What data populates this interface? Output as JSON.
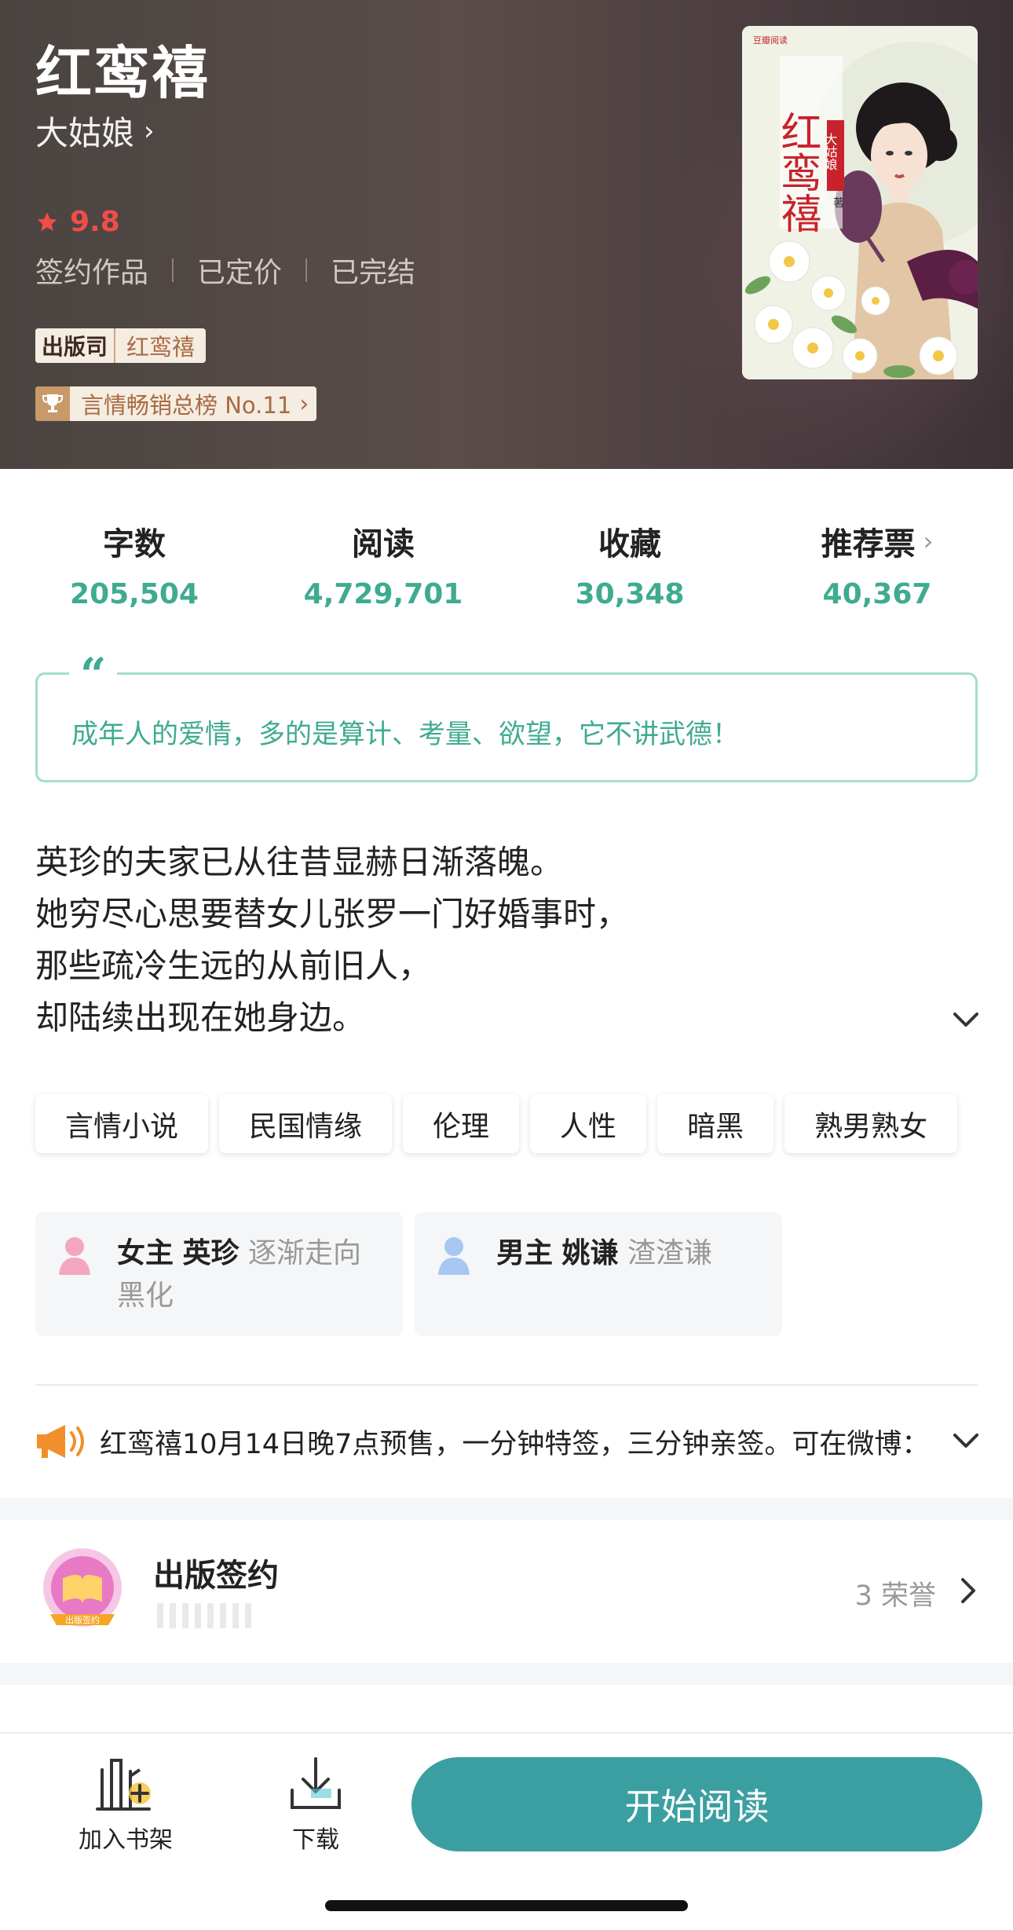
{
  "book": {
    "title": "红鸾禧",
    "author": "大姑娘",
    "rating": "9.8",
    "meta": [
      "签约作品",
      "已定价",
      "已完结"
    ],
    "publisher_logo": "出版司",
    "publisher_name": "红鸾禧",
    "rank_text": "言情畅销总榜 No.11",
    "cover": {
      "brand": "豆瓣阅读",
      "title": "红鸾禧",
      "author": "大姑娘",
      "suffix": "著"
    }
  },
  "stats": [
    {
      "label": "字数",
      "value": "205,504"
    },
    {
      "label": "阅读",
      "value": "4,729,701"
    },
    {
      "label": "收藏",
      "value": "30,348"
    },
    {
      "label": "推荐票",
      "value": "40,367"
    }
  ],
  "quote": "成年人的爱情，多的是算计、考量、欲望，它不讲武德！",
  "synopsis": [
    "英珍的夫家已从往昔显赫日渐落魄。",
    "她穷尽心思要替女儿张罗一门好婚事时，",
    "那些疏冷生远的从前旧人，",
    "却陆续出现在她身边。"
  ],
  "tags": [
    "言情小说",
    "民国情缘",
    "伦理",
    "人性",
    "暗黑",
    "熟男熟女"
  ],
  "characters": [
    {
      "role": "女主",
      "name": "英珍",
      "desc_line1": "逐渐走向",
      "desc_line2": "黑化",
      "color": "#f4a6c0"
    },
    {
      "role": "男主",
      "name": "姚谦",
      "desc_line1": "渣渣谦",
      "desc_line2": "",
      "color": "#a8c6f2"
    }
  ],
  "notice": "红鸾禧10月14日晚7点预售，一分钟特签，三分钟亲签。可在微博：",
  "honor": {
    "title": "出版签约",
    "medal_text": "出版签约",
    "count": "3 荣誉"
  },
  "bottom": {
    "shelf_label": "加入书架",
    "download_label": "下载",
    "read_label": "开始阅读"
  },
  "colors": {
    "accent": "#3fab90",
    "read_button": "#3b9fa1",
    "rating": "#f04d4a"
  }
}
